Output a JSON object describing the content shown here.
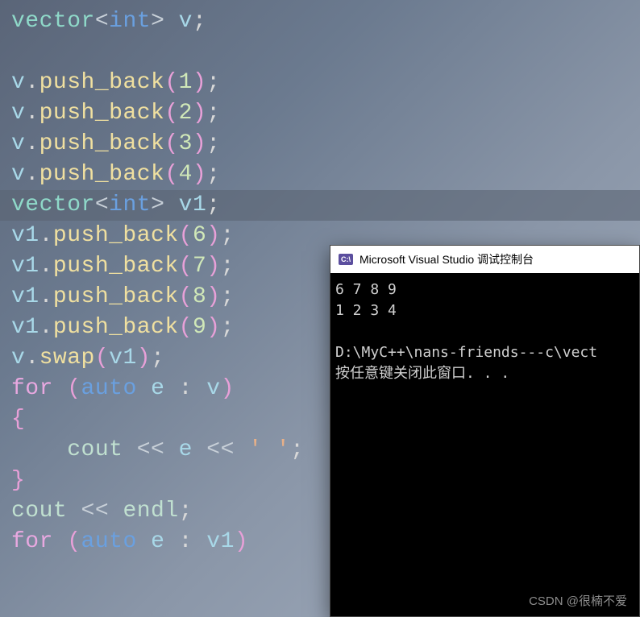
{
  "code": {
    "line1": {
      "type": "vector",
      "angle1": "<",
      "inner": "int",
      "angle2": "> ",
      "var": "v",
      "semi": ";"
    },
    "line2": "",
    "line3": {
      "var": "v",
      "dot": ".",
      "method": "push_back",
      "open": "(",
      "num": "1",
      "close": ")",
      "semi": ";"
    },
    "line4": {
      "var": "v",
      "dot": ".",
      "method": "push_back",
      "open": "(",
      "num": "2",
      "close": ")",
      "semi": ";"
    },
    "line5": {
      "var": "v",
      "dot": ".",
      "method": "push_back",
      "open": "(",
      "num": "3",
      "close": ")",
      "semi": ";"
    },
    "line6": {
      "var": "v",
      "dot": ".",
      "method": "push_back",
      "open": "(",
      "num": "4",
      "close": ")",
      "semi": ";"
    },
    "line7": {
      "type": "vector",
      "angle1": "<",
      "inner": "int",
      "angle2": "> ",
      "var": "v1",
      "semi": ";"
    },
    "line8": {
      "var": "v1",
      "dot": ".",
      "method": "push_back",
      "open": "(",
      "num": "6",
      "close": ")",
      "semi": ";"
    },
    "line9": {
      "var": "v1",
      "dot": ".",
      "method": "push_back",
      "open": "(",
      "num": "7",
      "close": ")",
      "semi": ";"
    },
    "line10": {
      "var": "v1",
      "dot": ".",
      "method": "push_back",
      "open": "(",
      "num": "8",
      "close": ")",
      "semi": ";"
    },
    "line11": {
      "var": "v1",
      "dot": ".",
      "method": "push_back",
      "open": "(",
      "num": "9",
      "close": ")",
      "semi": ";"
    },
    "line12": {
      "var": "v",
      "dot": ".",
      "method": "swap",
      "open": "(",
      "arg": "v1",
      "close": ")",
      "semi": ";"
    },
    "line13": {
      "kw": "for ",
      "open": "(",
      "auto": "auto",
      "sp": " ",
      "e": "e",
      "colon": " : ",
      "var": "v",
      "close": ")"
    },
    "line14": {
      "brace": "{"
    },
    "line15": {
      "indent": "    ",
      "cout": "cout",
      "op1": " << ",
      "e": "e",
      "op2": " << ",
      "str": "' '",
      "semi": ";"
    },
    "line16": {
      "brace": "}"
    },
    "line17": {
      "cout": "cout",
      "op": " << ",
      "endl": "endl",
      "semi": ";"
    },
    "line18": {
      "kw": "for ",
      "open": "(",
      "auto": "auto",
      "sp": " ",
      "e": "e",
      "colon": " : ",
      "var": "v1",
      "close": ")"
    }
  },
  "console": {
    "icon_text": "C:\\",
    "title": "Microsoft Visual Studio 调试控制台",
    "out1": "6 7 8 9",
    "out2": "1 2 3 4",
    "blank": "",
    "path": "D:\\MyC++\\nans-friends---c\\vect",
    "prompt": "按任意键关闭此窗口. . ."
  },
  "watermark": "CSDN @很楠不爱"
}
